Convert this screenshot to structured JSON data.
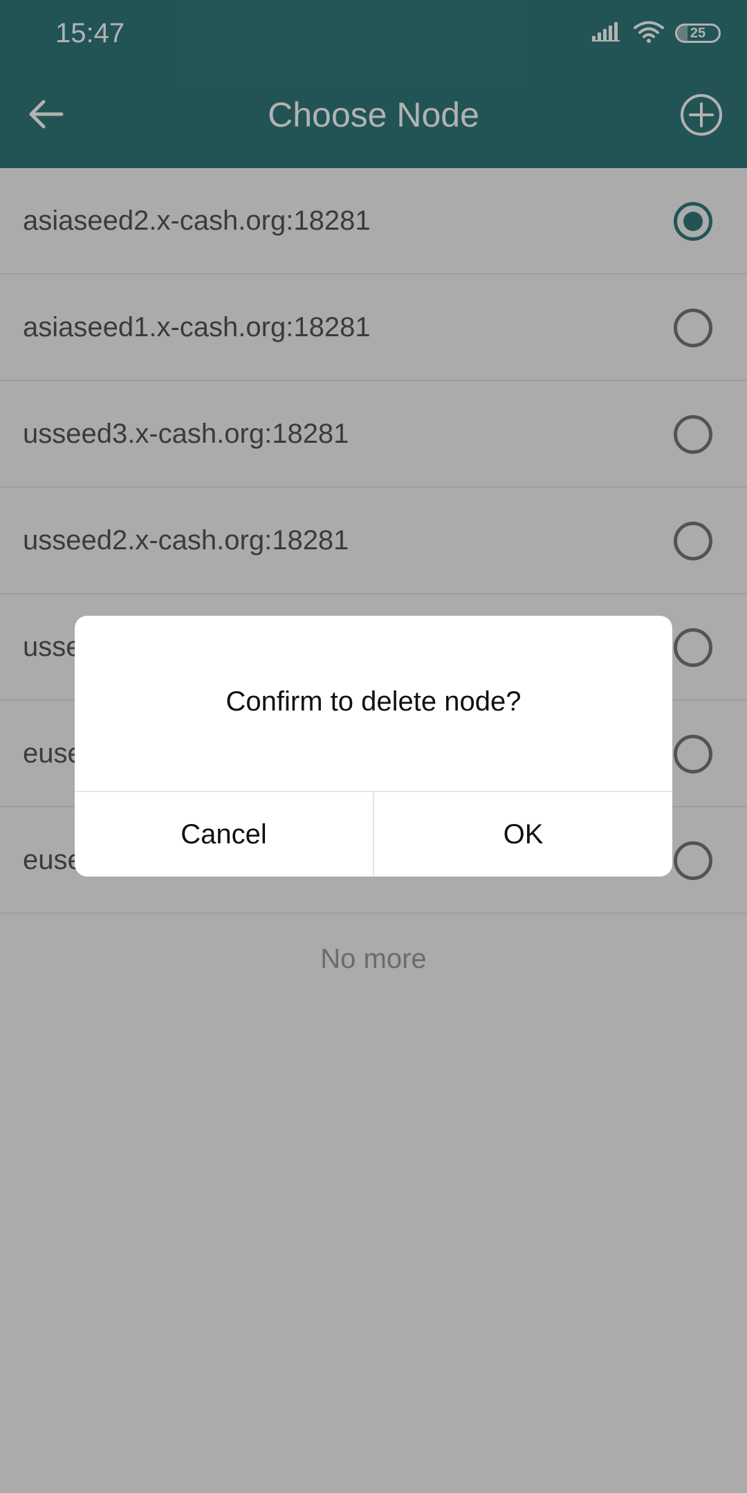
{
  "status_bar": {
    "time": "15:47",
    "battery": "25",
    "battery_level": 0.25,
    "icons": [
      "signal-icon",
      "wifi-icon",
      "battery-icon"
    ]
  },
  "header": {
    "title": "Choose Node",
    "back_icon": "arrow-left-icon",
    "add_icon": "plus-circle-icon"
  },
  "nodes": [
    {
      "label": "asiaseed2.x-cash.org:18281",
      "selected": true
    },
    {
      "label": "asiaseed1.x-cash.org:18281",
      "selected": false
    },
    {
      "label": "usseed3.x-cash.org:18281",
      "selected": false
    },
    {
      "label": "usseed2.x-cash.org:18281",
      "selected": false
    },
    {
      "label": "usse",
      "selected": false
    },
    {
      "label": "euse",
      "selected": false
    },
    {
      "label": "euse",
      "selected": false
    }
  ],
  "list_footer": "No more",
  "dialog": {
    "message": "Confirm to delete node?",
    "cancel_label": "Cancel",
    "ok_label": "OK"
  },
  "colors": {
    "primary": "#32797b",
    "background": "#f5f5f5",
    "scrim": "rgba(0,0,0,0.30)"
  }
}
